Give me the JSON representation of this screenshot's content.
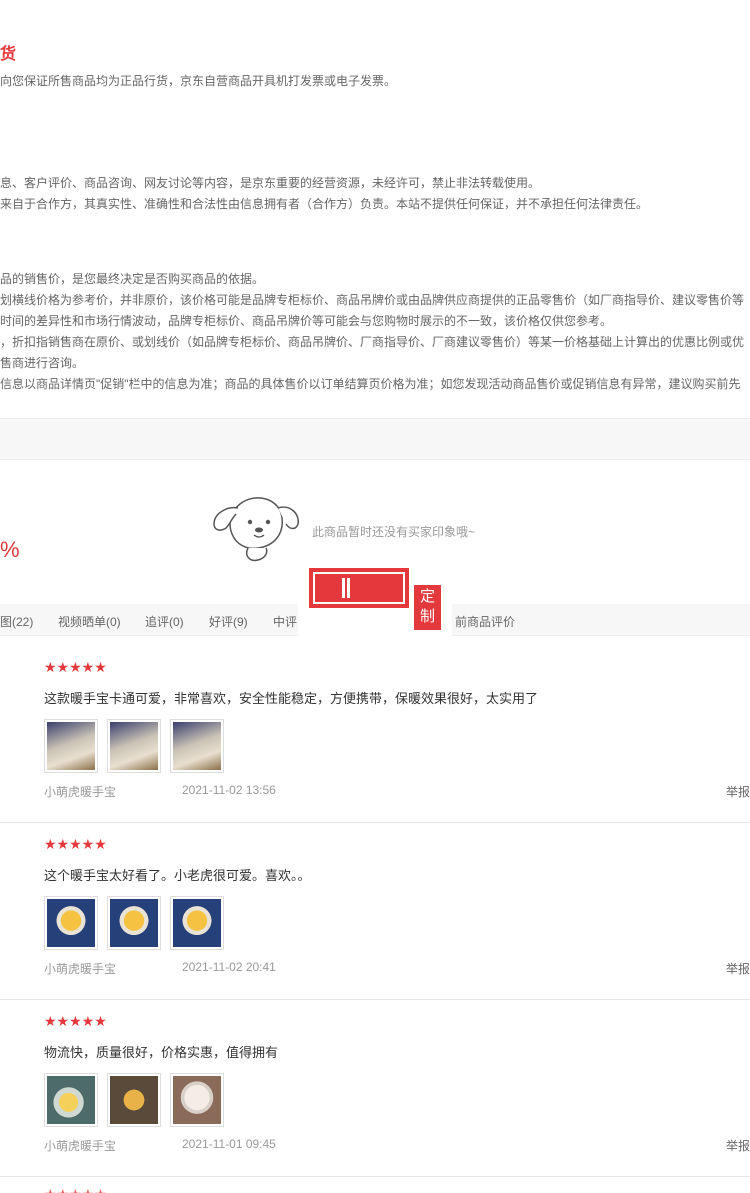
{
  "notice": {
    "title": "货",
    "line1": "向您保证所售商品均为正品行货，京东自营商品开具机打发票或电子发票。",
    "line2": "息、客户评价、商品咨询、网友讨论等内容，是京东重要的经营资源，未经许可，禁止非法转载使用。",
    "line3": "来自于合作方，其真实性、准确性和合法性由信息拥有者（合作方）负责。本站不提供任何保证，并不承担任何法律责任。",
    "line4": "品的销售价，是您最终决定是否购买商品的依据。",
    "line5": "划横线价格为参考价，并非原价，该价格可能是品牌专柜标价、商品吊牌价或由品牌供应商提供的正品零售价（如厂商指导价、建议零售价等",
    "line6": "时间的差异性和市场行情波动，品牌专柜标价、商品吊牌价等可能会与您购物时展示的不一致，该价格仅供您参考。",
    "line7": "，折扣指销售商在原价、或划线价（如品牌专柜标价、商品吊牌价、厂商指导价、厂商建议零售价）等某一价格基础上计算出的优惠比例或优",
    "line8": "售商进行咨询。",
    "line9": "信息以商品详情页\"促销\"栏中的信息为准；商品的具体售价以订单结算页价格为准；如您发现活动商品售价或促销信息有异常，建议购买前先"
  },
  "summary": {
    "rate_pct": "%",
    "empty_text": "此商品暂时还没有买家印象哦~"
  },
  "float_tag": {
    "char1": "定",
    "char2": "制"
  },
  "tabs": [
    {
      "label": "图(22)"
    },
    {
      "label": "视频晒单(0)"
    },
    {
      "label": "追评(0)"
    },
    {
      "label": "好评(9)"
    },
    {
      "label": "中评"
    },
    {
      "label": "前商品评价"
    }
  ],
  "reviews": [
    {
      "stars": "★★★★★",
      "content": "这款暖手宝卡通可爱，非常喜欢，安全性能稳定，方便携带，保暖效果很好，太实用了",
      "user": "小萌虎暖手宝",
      "time": "2021-11-02 13:56",
      "report": "举报"
    },
    {
      "stars": "★★★★★",
      "content": "这个暖手宝太好看了。小老虎很可爱。喜欢。。",
      "user": "小萌虎暖手宝",
      "time": "2021-11-02 20:41",
      "report": "举报"
    },
    {
      "stars": "★★★★★",
      "content": "物流快，质量很好，价格实惠，值得拥有",
      "user": "小萌虎暖手宝",
      "time": "2021-11-01 09:45",
      "report": "举报"
    }
  ],
  "colors": {
    "accent": "#e4393c",
    "text": "#666666",
    "muted": "#999999"
  }
}
